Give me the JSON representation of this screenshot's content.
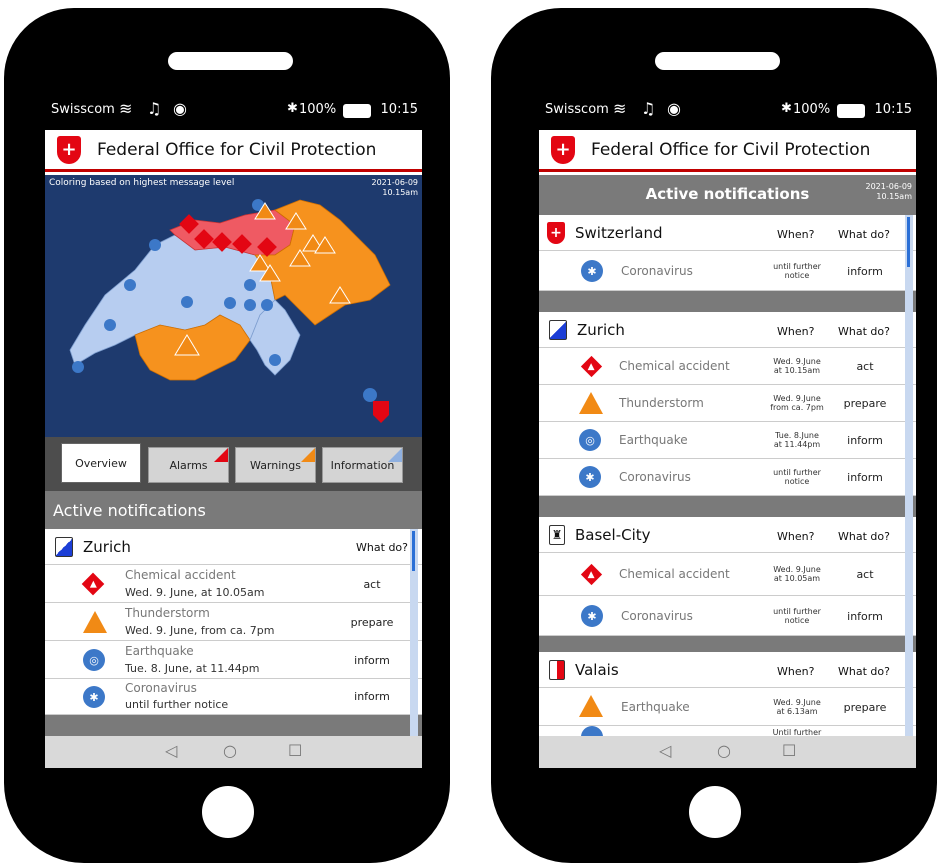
{
  "status": {
    "carrier": "Swisscom",
    "battery": "100%",
    "time": "10:15"
  },
  "app": {
    "title": "Federal Office for Civil Protection"
  },
  "left": {
    "map": {
      "caption": "Coloring based on highest message level",
      "date": "2021-06-09",
      "time": "10.15am"
    },
    "tabs": [
      {
        "label": "Overview",
        "corner": ""
      },
      {
        "label": "Alarms",
        "corner": "#e30613"
      },
      {
        "label": "Warnings",
        "corner": "#f18a15"
      },
      {
        "label": "Information",
        "corner": "#8fb0e0"
      }
    ],
    "section_title": "Active notifications",
    "region": {
      "name": "Zurich",
      "what_hdr": "What do?"
    },
    "notifications": [
      {
        "title": "Chemical accident",
        "detail": "Wed. 9. June, at 10.05am",
        "action": "act",
        "icon": "chemical-accident-icon"
      },
      {
        "title": "Thunderstorm",
        "detail": "Wed. 9. June, from ca. 7pm",
        "action": "prepare",
        "icon": "thunderstorm-icon"
      },
      {
        "title": "Earthquake",
        "detail": "Tue. 8. June, at 11.44pm",
        "action": "inform",
        "icon": "earthquake-icon"
      },
      {
        "title": "Coronavirus",
        "detail": "until further notice",
        "action": "inform",
        "icon": "coronavirus-icon"
      }
    ],
    "nav": {
      "back": "◁",
      "home": "○",
      "recent": "☐"
    }
  },
  "right": {
    "header": {
      "title": "Active notifications",
      "date": "2021-06-09",
      "time": "10.15am"
    },
    "cols": {
      "when": "When?",
      "what": "What do?"
    },
    "regions": [
      {
        "name": "Switzerland",
        "items": [
          {
            "title": "Coronavirus",
            "when1": "until further",
            "when2": "notice",
            "action": "inform"
          }
        ]
      },
      {
        "name": "Zurich",
        "items": [
          {
            "title": "Chemical accident",
            "when1": "Wed. 9.June",
            "when2": "at 10.15am",
            "action": "act"
          },
          {
            "title": "Thunderstorm",
            "when1": "Wed. 9.June",
            "when2": "from ca. 7pm",
            "action": "prepare"
          },
          {
            "title": "Earthquake",
            "when1": "Tue. 8.June",
            "when2": "at 11.44pm",
            "action": "inform"
          },
          {
            "title": "Coronavirus",
            "when1": "until further",
            "when2": "notice",
            "action": "inform"
          }
        ]
      },
      {
        "name": "Basel-City",
        "items": [
          {
            "title": "Chemical accident",
            "when1": "Wed. 9.June",
            "when2": "at 10.05am",
            "action": "act"
          },
          {
            "title": "Coronavirus",
            "when1": "until further",
            "when2": "notice",
            "action": "inform"
          }
        ]
      },
      {
        "name": "Valais",
        "items": [
          {
            "title": "Earthquake",
            "when1": "Wed. 9.June",
            "when2": "at 6.13am",
            "action": "prepare"
          },
          {
            "title": "",
            "when1": "Until further",
            "when2": "",
            "action": ""
          }
        ]
      }
    ],
    "nav": {
      "back": "◁",
      "home": "○",
      "recent": "☐"
    }
  },
  "colors": {
    "alarm": "#e30613",
    "warning": "#f18a15",
    "info": "#3c78c8",
    "map_bg": "#1e3a6e"
  }
}
